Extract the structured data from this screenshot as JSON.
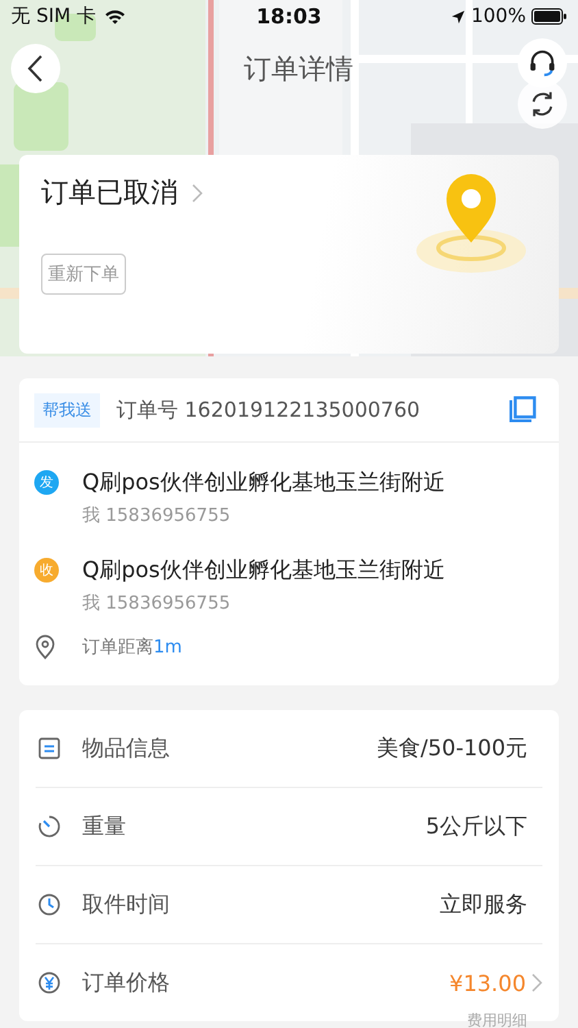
{
  "status_bar": {
    "carrier": "无 SIM 卡",
    "time": "18:03",
    "battery": "100%"
  },
  "nav": {
    "title": "订单详情"
  },
  "status_card": {
    "title": "订单已取消",
    "button": "重新下单"
  },
  "order": {
    "tag": "帮我送",
    "number": "订单号 162019122135000760",
    "stops": [
      {
        "badge": "发",
        "color": "#1ea7f2",
        "address": "Q刷pos伙伴创业孵化基地玉兰街附近",
        "contact": "我 15836956755"
      },
      {
        "badge": "收",
        "color": "#f7ab2e",
        "address": "Q刷pos伙伴创业孵化基地玉兰街附近",
        "contact": "我 15836956755"
      }
    ],
    "distance": {
      "label": "订单距离",
      "value": "1m"
    }
  },
  "details": [
    {
      "kind": "goods",
      "label": "物品信息",
      "value": "美食/50-100元"
    },
    {
      "kind": "weight",
      "label": "重量",
      "value": "5公斤以下"
    },
    {
      "kind": "time",
      "label": "取件时间",
      "value": "立即服务"
    },
    {
      "kind": "price",
      "label": "订单价格",
      "value": "¥13.00",
      "link": "费用明细"
    }
  ]
}
